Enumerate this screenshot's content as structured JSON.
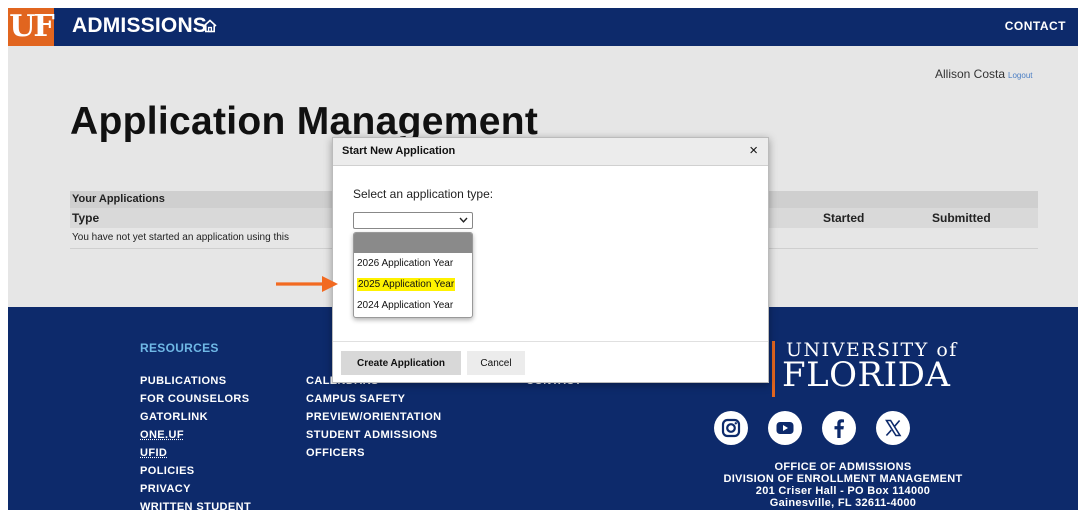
{
  "header": {
    "logo": "UF",
    "brand": "ADMISSIONS",
    "contact": "CONTACT"
  },
  "user": {
    "name": "Allison Costa",
    "logout": "Logout"
  },
  "page_title": "Application Management",
  "applications": {
    "caption": "Your Applications",
    "columns": [
      "Type",
      "Started",
      "Submitted"
    ],
    "empty_message": "You have not yet started an application using this"
  },
  "dialog": {
    "title": "Start New Application",
    "close": "×",
    "label": "Select an application type:",
    "selected_value": "",
    "options": [
      "2026 Application Year",
      "2025 Application Year",
      "2024 Application Year"
    ],
    "highlighted_option": "2025 Application Year",
    "create_button": "Create Application",
    "cancel_button": "Cancel"
  },
  "annotation": {
    "arrow_color": "#f26a21"
  },
  "footer": {
    "resources_title": "RESOURCES",
    "col1": [
      "PUBLICATIONS",
      "FOR COUNSELORS",
      "GATORLINK",
      "ONE.UF",
      "UFID",
      "POLICIES",
      "PRIVACY",
      "WRITTEN STUDENT"
    ],
    "col2": [
      "CALENDARS",
      "CAMPUS SAFETY",
      "PREVIEW/ORIENTATION",
      "STUDENT ADMISSIONS",
      "OFFICERS"
    ],
    "col3": [
      "CONTACT"
    ],
    "university_line": "UNIVERSITY of",
    "florida_line": "FLORIDA",
    "big_logo": "UF",
    "social": [
      "instagram-icon",
      "youtube-icon",
      "facebook-icon",
      "x-icon"
    ],
    "address": [
      "OFFICE OF ADMISSIONS",
      "DIVISION OF ENROLLMENT MANAGEMENT",
      "201 Criser Hall - PO Box 114000",
      "Gainesville, FL 32611-4000"
    ]
  },
  "colors": {
    "navy": "#0d2a6b",
    "orange": "#e1651f",
    "highlight": "#fff200",
    "link_blue": "#4a7ec4"
  }
}
